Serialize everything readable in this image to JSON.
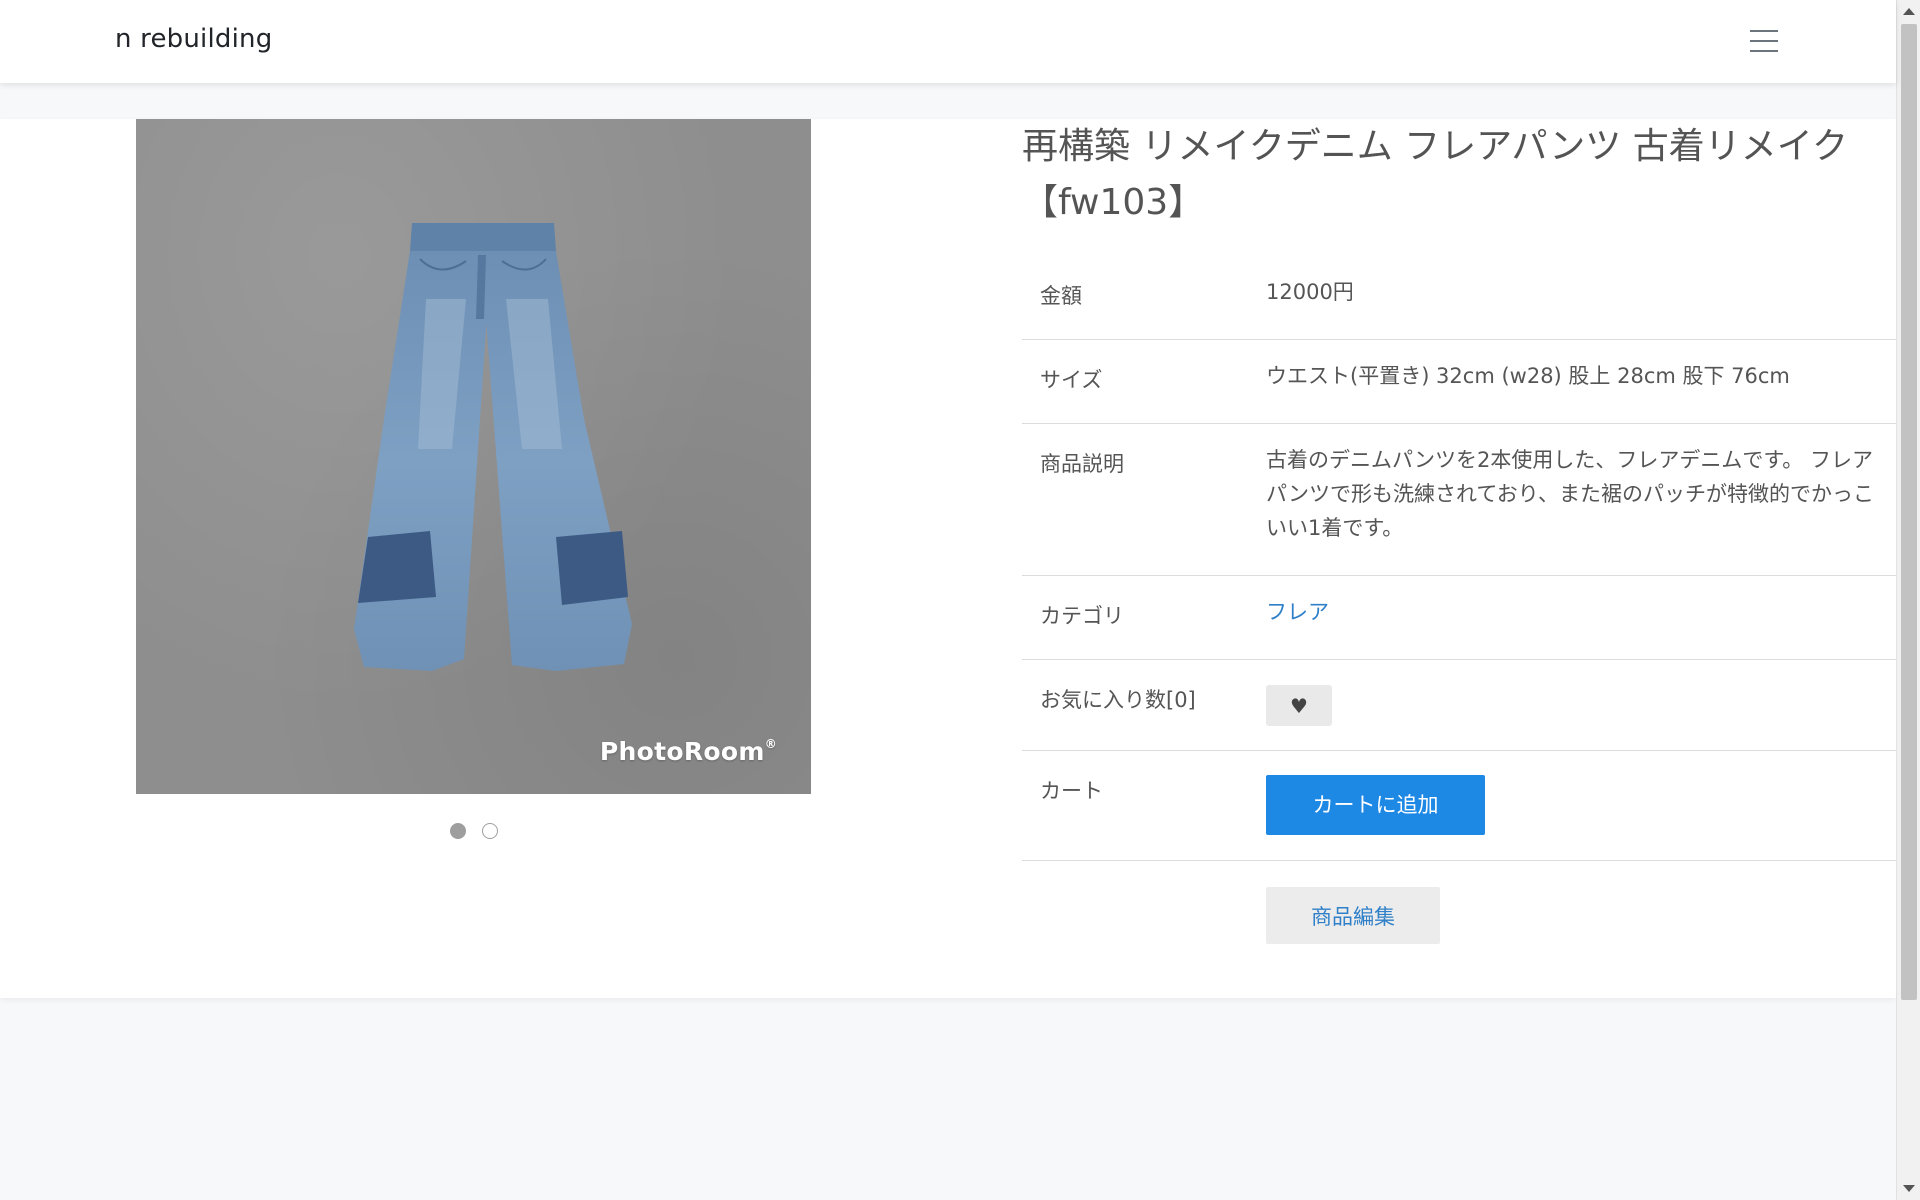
{
  "navbar": {
    "brand": "n rebuilding",
    "menu_icon": "hamburger-menu-icon"
  },
  "product": {
    "title": "再構築 リメイクデニム フレアパンツ 古着リメイク【fw103】",
    "photo_watermark": "PhotoRoom",
    "photo_watermark_mark": "®",
    "carousel": {
      "count": 2,
      "active_index": 0
    },
    "rows": {
      "price": {
        "label": "金額",
        "value": "12000円"
      },
      "size": {
        "label": "サイズ",
        "value": "ウエスト(平置き) 32cm (w28) 股上 28cm 股下 76cm"
      },
      "description": {
        "label": "商品説明",
        "value": "古着のデニムパンツを2本使用した、フレアデニムです。 フレアパンツで形も洗練されており、また裾のパッチが特徴的でかっこいい1着です。"
      },
      "category": {
        "label": "カテゴリ",
        "value": "フレア"
      },
      "favorites": {
        "label": "お気に入り数[0]",
        "icon": "heart-icon"
      },
      "cart": {
        "label": "カート",
        "button": "カートに追加"
      },
      "edit": {
        "button": "商品編集"
      }
    }
  },
  "colors": {
    "primary_button": "#1e88e5",
    "link": "#2f80c8",
    "page_background": "#f7f8fa"
  }
}
